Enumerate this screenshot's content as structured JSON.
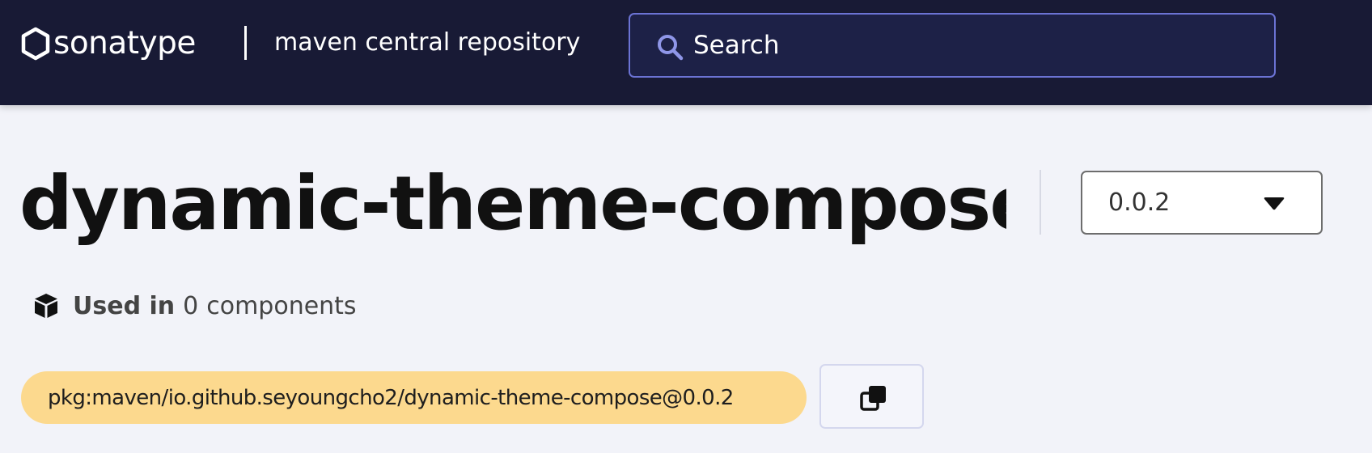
{
  "header": {
    "brand": "sonatype",
    "subtitle": "maven central repository",
    "search": {
      "placeholder": "Search",
      "icon": "search-icon"
    },
    "colors": {
      "background": "#181a35",
      "search_bg": "#1d2147",
      "search_border": "#6b73d4"
    }
  },
  "artifact": {
    "title": "dynamic-theme-compose",
    "version": {
      "selected": "0.0.2",
      "icon": "caret-down-icon"
    },
    "usage": {
      "label": "Used in",
      "count": "0",
      "unit": "components",
      "icon": "cube-icon"
    },
    "purl": "pkg:maven/io.github.seyoungcho2/dynamic-theme-compose@0.0.2",
    "copy": {
      "icon": "copy-icon"
    },
    "colors": {
      "purl_bg": "#fcd98e",
      "page_bg": "#f2f3f9"
    }
  }
}
